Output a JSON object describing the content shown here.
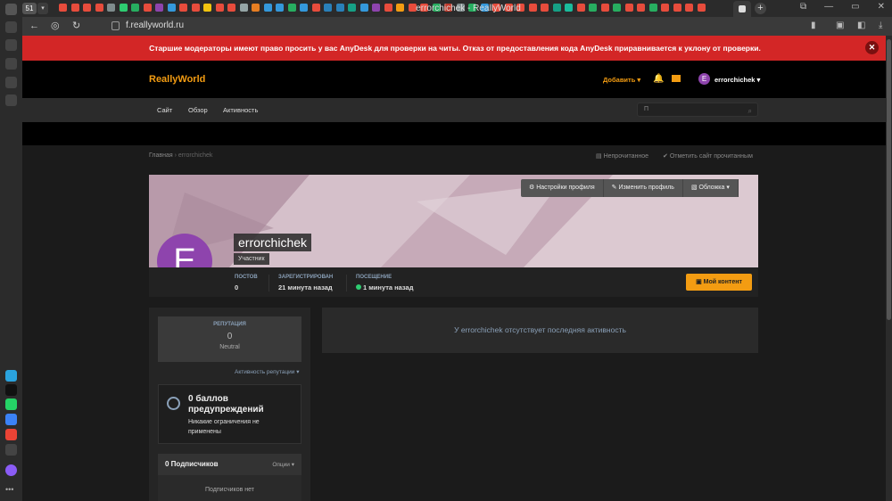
{
  "browser": {
    "window_title": "errorchichek - ReallyWorld",
    "url": "f.reallyworld.ru",
    "workspace_number": "51",
    "tab_icon_colors": [
      "#e74c3c",
      "#e74c3c",
      "#e74c3c",
      "#e74c3c",
      "#7f8c8d",
      "#2ecc71",
      "#27ae60",
      "#e74c3c",
      "#8e44ad",
      "#3498db",
      "#e74c3c",
      "#e74c3c",
      "#f1c40f",
      "#e74c3c",
      "#e74c3c",
      "#95a5a6",
      "#e67e22",
      "#3498db",
      "#3498db",
      "#27ae60",
      "#3498db",
      "#e74c3c",
      "#2980b9",
      "#2980b9",
      "#16a085",
      "#3498db",
      "#8e44ad",
      "#e74c3c",
      "#f39c12",
      "#e74c3c",
      "#e74c3c",
      "#27ae60",
      "#c0392b",
      "#7f8c8d",
      "#27ae60",
      "#3498db",
      "#e74c3c",
      "#e74c3c",
      "#e74c3c",
      "#e74c3c",
      "#e74c3c",
      "#16a085",
      "#1abc9c",
      "#e74c3c",
      "#27ae60",
      "#e74c3c",
      "#27ae60",
      "#e74c3c",
      "#e74c3c",
      "#27ae60",
      "#e74c3c",
      "#e74c3c",
      "#e74c3c",
      "#e74c3c"
    ]
  },
  "notice": {
    "text": "Старшие модераторы имеют право просить у вас AnyDesk для проверки на читы. Отказ от предоставления кода AnyDesk приравнивается к уклону от проверки."
  },
  "header": {
    "logo": "ReallyWorld",
    "add_label": "Добавить ▾",
    "username": "errorchichek ▾",
    "avatar_letter": "E",
    "nav": [
      "Сайт",
      "Обзор",
      "Активность"
    ],
    "search_placeholder": "П"
  },
  "breadcrumb": {
    "home": "Главная",
    "current": "errorchichek"
  },
  "toolbar": {
    "unread": "Непрочитанное",
    "mark_read": "Отметить сайт прочитанным"
  },
  "profile": {
    "cover_actions": [
      "Настройки профиля",
      "Изменить профиль",
      "Обложка ▾"
    ],
    "avatar_letter": "E",
    "name": "errorchichek",
    "role": "Участник",
    "stats": [
      {
        "label": "ПОСТОВ",
        "value": "0"
      },
      {
        "label": "ЗАРЕГИСТРИРОВАН",
        "value": "21 минута назад"
      },
      {
        "label": "ПОСЕЩЕНИЕ",
        "value": "1 минута назад"
      }
    ],
    "my_content": "Мой контент"
  },
  "reputation": {
    "label": "РЕПУТАЦИЯ",
    "value": "0",
    "status": "Neutral",
    "activity_link": "Активность репутации ▾"
  },
  "warnings": {
    "title": "0 баллов предупреждений",
    "subtitle": "Никакие ограничения не применены"
  },
  "subscribers": {
    "title": "0 Подписчиков",
    "options": "Опции ▾",
    "empty": "Подписчиков нет"
  },
  "activity": {
    "empty": "У errorchichek отсутствует последняя активность"
  },
  "colors": {
    "accent": "#f39c12",
    "notice_red": "#d32626",
    "avatar_purple": "#8e44ad",
    "online_green": "#2ecc71"
  }
}
